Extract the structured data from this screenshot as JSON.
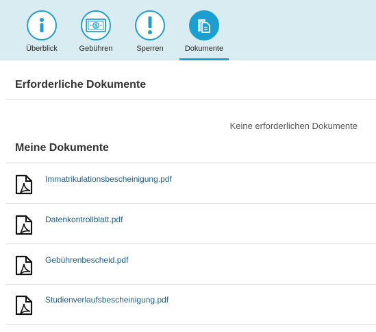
{
  "tabs": [
    {
      "label": "Überblick",
      "icon": "info-icon",
      "active": false
    },
    {
      "label": "Gebühren",
      "icon": "money-icon",
      "active": false
    },
    {
      "label": "Sperren",
      "icon": "exclamation-icon",
      "active": false
    },
    {
      "label": "Dokumente",
      "icon": "documents-icon",
      "active": true
    }
  ],
  "required_documents": {
    "title": "Erforderliche Dokumente",
    "empty_text": "Keine erforderlichen Dokumente"
  },
  "my_documents": {
    "title": "Meine Dokumente",
    "files": [
      {
        "name": "Immatrikulationsbescheinigung.pdf",
        "icon": "pdf-file-icon"
      },
      {
        "name": "Datenkontrollblatt.pdf",
        "icon": "pdf-file-icon"
      },
      {
        "name": "Gebührenbescheid.pdf",
        "icon": "pdf-file-icon"
      },
      {
        "name": "Studienverlaufsbescheinigung.pdf",
        "icon": "pdf-file-icon"
      }
    ]
  },
  "colors": {
    "accent": "#1a9fd0",
    "tabbar_bg": "#d9ecf1",
    "link": "#1a5e8a"
  }
}
